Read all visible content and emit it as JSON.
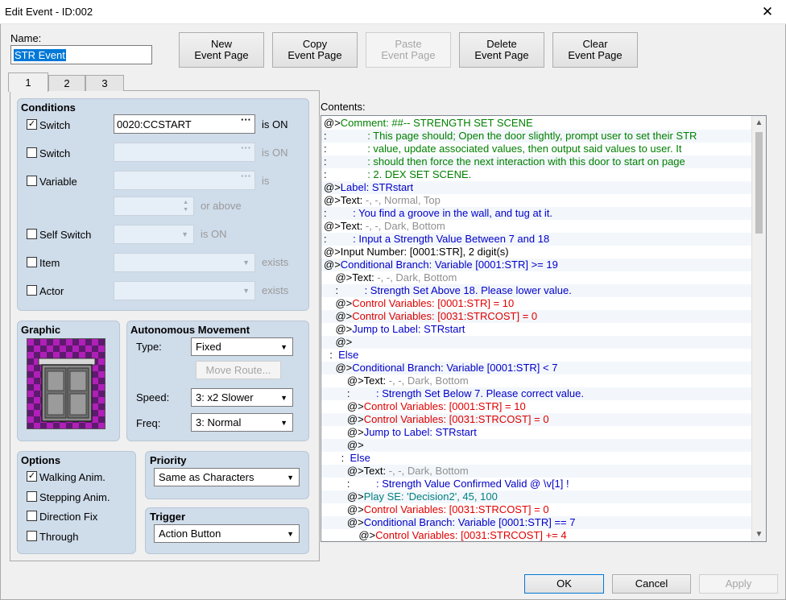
{
  "window": {
    "title": "Edit Event - ID:002",
    "close_glyph": "✕"
  },
  "name": {
    "label": "Name:",
    "value": "STR Event"
  },
  "toolbar": {
    "new": [
      "New",
      "Event Page"
    ],
    "copy": [
      "Copy",
      "Event Page"
    ],
    "paste": [
      "Paste",
      "Event Page"
    ],
    "delete": [
      "Delete",
      "Event Page"
    ],
    "clear": [
      "Clear",
      "Event Page"
    ]
  },
  "tabs": [
    "1",
    "2",
    "3"
  ],
  "conditions": {
    "title": "Conditions",
    "switch1": {
      "label": "Switch",
      "value": "0020:CCSTART",
      "suffix": "is ON",
      "checked": true
    },
    "switch2": {
      "label": "Switch",
      "value": "",
      "suffix": "is ON",
      "checked": false
    },
    "variable": {
      "label": "Variable",
      "value": "",
      "suffix": "is",
      "checked": false
    },
    "or_above": "or above",
    "self_switch": {
      "label": "Self Switch",
      "suffix": "is ON",
      "checked": false
    },
    "item": {
      "label": "Item",
      "suffix": "exists",
      "checked": false
    },
    "actor": {
      "label": "Actor",
      "suffix": "exists",
      "checked": false
    },
    "ellipsis": "···"
  },
  "graphic": {
    "title": "Graphic"
  },
  "autonomous": {
    "title": "Autonomous Movement",
    "type_label": "Type:",
    "type_value": "Fixed",
    "move_route": "Move Route...",
    "speed_label": "Speed:",
    "speed_value": "3: x2 Slower",
    "freq_label": "Freq:",
    "freq_value": "3: Normal"
  },
  "options": {
    "title": "Options",
    "walking": {
      "label": "Walking Anim.",
      "checked": true
    },
    "stepping": {
      "label": "Stepping Anim.",
      "checked": false
    },
    "direction": {
      "label": "Direction Fix",
      "checked": false
    },
    "through": {
      "label": "Through",
      "checked": false
    }
  },
  "priority": {
    "title": "Priority",
    "value": "Same as Characters"
  },
  "trigger": {
    "title": "Trigger",
    "value": "Action Button"
  },
  "contents": {
    "label": "Contents:",
    "lines": [
      [
        [
          "c-black",
          "@>"
        ],
        [
          "c-green",
          "Comment: ##-- STRENGTH SET SCENE"
        ]
      ],
      [
        [
          "c-black",
          ":"
        ],
        [
          "c-green",
          "              : This page should; Open the door slightly, prompt user to set their STR"
        ]
      ],
      [
        [
          "c-black",
          ":"
        ],
        [
          "c-green",
          "              : value, update associated values, then output said values to user. It"
        ]
      ],
      [
        [
          "c-black",
          ":"
        ],
        [
          "c-green",
          "              : should then force the next interaction with this door to start on page"
        ]
      ],
      [
        [
          "c-black",
          ":"
        ],
        [
          "c-green",
          "              : 2. DEX SET SCENE."
        ]
      ],
      [
        [
          "c-black",
          "@>"
        ],
        [
          "c-blue",
          "Label: STRstart"
        ]
      ],
      [
        [
          "c-black",
          "@>Text: "
        ],
        [
          "c-gray",
          "-, -, Normal, Top"
        ]
      ],
      [
        [
          "c-black",
          ":"
        ],
        [
          "c-blue",
          "         : You find a groove in the wall, and tug at it."
        ]
      ],
      [
        [
          "c-black",
          "@>Text: "
        ],
        [
          "c-gray",
          "-, -, Dark, Bottom"
        ]
      ],
      [
        [
          "c-black",
          ":"
        ],
        [
          "c-blue",
          "         : Input a Strength Value Between 7 and 18"
        ]
      ],
      [
        [
          "c-black",
          "@>Input Number: [0001:STR], 2 digit(s)"
        ]
      ],
      [
        [
          "c-black",
          "@>"
        ],
        [
          "c-blue",
          "Conditional Branch: Variable [0001:STR] >= 19"
        ]
      ],
      [
        [
          "c-black",
          "    @>Text: "
        ],
        [
          "c-gray",
          "-, -, Dark, Bottom"
        ]
      ],
      [
        [
          "c-black",
          "    :"
        ],
        [
          "c-blue",
          "         : Strength Set Above 18. Please lower value."
        ]
      ],
      [
        [
          "c-black",
          "    @>"
        ],
        [
          "c-red",
          "Control Variables: [0001:STR] = 10"
        ]
      ],
      [
        [
          "c-black",
          "    @>"
        ],
        [
          "c-red",
          "Control Variables: [0031:STRCOST] = 0"
        ]
      ],
      [
        [
          "c-black",
          "    @>"
        ],
        [
          "c-blue",
          "Jump to Label: STRstart"
        ]
      ],
      [
        [
          "c-black",
          "    @>"
        ]
      ],
      [
        [
          "c-black",
          "  :  "
        ],
        [
          "c-blue",
          "Else"
        ]
      ],
      [
        [
          "c-black",
          "    @>"
        ],
        [
          "c-blue",
          "Conditional Branch: Variable [0001:STR] < 7"
        ]
      ],
      [
        [
          "c-black",
          "        @>Text: "
        ],
        [
          "c-gray",
          "-, -, Dark, Bottom"
        ]
      ],
      [
        [
          "c-black",
          "        :"
        ],
        [
          "c-blue",
          "         : Strength Set Below 7. Please correct value."
        ]
      ],
      [
        [
          "c-black",
          "        @>"
        ],
        [
          "c-red",
          "Control Variables: [0001:STR] = 10"
        ]
      ],
      [
        [
          "c-black",
          "        @>"
        ],
        [
          "c-red",
          "Control Variables: [0031:STRCOST] = 0"
        ]
      ],
      [
        [
          "c-black",
          "        @>"
        ],
        [
          "c-blue",
          "Jump to Label: STRstart"
        ]
      ],
      [
        [
          "c-black",
          "        @>"
        ]
      ],
      [
        [
          "c-black",
          "      :  "
        ],
        [
          "c-blue",
          "Else"
        ]
      ],
      [
        [
          "c-black",
          "        @>Text: "
        ],
        [
          "c-gray",
          "-, -, Dark, Bottom"
        ]
      ],
      [
        [
          "c-black",
          "        :"
        ],
        [
          "c-blue",
          "         : Strength Value Confirmed Valid @ \\v[1] !"
        ]
      ],
      [
        [
          "c-black",
          "        @>"
        ],
        [
          "c-teal",
          "Play SE: 'Decision2', 45, 100"
        ]
      ],
      [
        [
          "c-black",
          "        @>"
        ],
        [
          "c-red",
          "Control Variables: [0031:STRCOST] = 0"
        ]
      ],
      [
        [
          "c-black",
          "        @>"
        ],
        [
          "c-blue",
          "Conditional Branch: Variable [0001:STR] == 7"
        ]
      ],
      [
        [
          "c-black",
          "            @>"
        ],
        [
          "c-red",
          "Control Variables: [0031:STRCOST] += 4"
        ]
      ]
    ]
  },
  "footer": {
    "ok": "OK",
    "cancel": "Cancel",
    "apply": "Apply"
  },
  "icons": {
    "scroll_up": "up-arrow-icon",
    "scroll_down": "down-arrow-icon",
    "dropdown": "chevron-down-icon"
  }
}
